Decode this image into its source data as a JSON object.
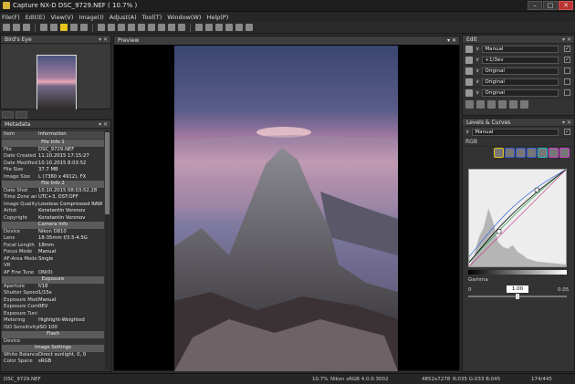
{
  "window": {
    "title": "Capture NX-D    DSC_9729.NEF ( 10.7% )"
  },
  "menu": [
    "File(F)",
    "Edit(E)",
    "View(V)",
    "Image(I)",
    "Adjust(A)",
    "Tool(T)",
    "Window(W)",
    "Help(P)"
  ],
  "panels": {
    "birds_eye": {
      "title": "Bird's Eye"
    },
    "metadata": {
      "title": "Metadata"
    },
    "preview": {
      "title": "Preview"
    },
    "edit": {
      "title": "Edit"
    },
    "levels": {
      "title": "Levels & Curves"
    }
  },
  "metadata": {
    "columns": [
      "Item",
      "Information"
    ],
    "rows": [
      {
        "section": "File Info 1"
      },
      {
        "k": "File",
        "v": "DSC_9729.NEF"
      },
      {
        "k": "Date Created",
        "v": "11.10.2015 17:15:27"
      },
      {
        "k": "Date Modified",
        "v": "10.10.2015 8:03:52"
      },
      {
        "k": "File Size",
        "v": "37.7 MB"
      },
      {
        "k": "Image Size",
        "v": "L (7360 x 4912), FX"
      },
      {
        "section": "File Info 2"
      },
      {
        "k": "Date Shot",
        "v": "10.10.2015 08:03:52.28"
      },
      {
        "k": "Time Zone an",
        "v": "UTC+3, DST:OFF"
      },
      {
        "k": "Image Quality",
        "v": "Lossless Compressed RAW"
      },
      {
        "k": "Artist",
        "v": "Konstantin Voronov"
      },
      {
        "k": "Copyright",
        "v": "Konstantin Voronov"
      },
      {
        "section": "Camera Info"
      },
      {
        "k": "Device",
        "v": "Nikon D810"
      },
      {
        "k": "Lens",
        "v": "18-35mm f/3.5-4.5G"
      },
      {
        "k": "Focal Length",
        "v": "18mm"
      },
      {
        "k": "Focus Mode",
        "v": "Manual"
      },
      {
        "k": "AF-Area Mode",
        "v": "Single"
      },
      {
        "k": "VR",
        "v": ""
      },
      {
        "k": "AF Fine Tune",
        "v": "ON(0)"
      },
      {
        "section": "Exposure"
      },
      {
        "k": "Aperture",
        "v": "f/18"
      },
      {
        "k": "Shutter Speed",
        "v": "1/15s"
      },
      {
        "k": "Exposure Mod",
        "v": "Manual"
      },
      {
        "k": "Exposure Com",
        "v": "0EV"
      },
      {
        "k": "Exposure Tuni",
        "v": ""
      },
      {
        "k": "Metering",
        "v": "Highlight-Weighted"
      },
      {
        "k": "ISO Sensitivity",
        "v": "ISO 100"
      },
      {
        "section": "Flash"
      },
      {
        "k": "Device",
        "v": ""
      },
      {
        "section": "Image Settings"
      },
      {
        "k": "White Balance",
        "v": "Direct sunlight, 0, 0"
      },
      {
        "k": "Color Space",
        "v": "sRGB"
      }
    ]
  },
  "edit": {
    "rows": [
      {
        "value": "Manual",
        "checked": "✓"
      },
      {
        "value": "+1/3ev",
        "checked": "✓"
      },
      {
        "value": "Original",
        "checked": ""
      },
      {
        "value": "Original",
        "checked": ""
      },
      {
        "value": "Original",
        "checked": ""
      }
    ]
  },
  "levels": {
    "preset": "Manual",
    "channel": "RGB",
    "gamma_label": "Gamma",
    "gamma_value": "1.00",
    "gamma_min": "0",
    "gamma_max": "0.05"
  },
  "status": {
    "file": "DSC_9729.NEF",
    "zoom": "10.7%",
    "profile": "Nikon sRGB 4.0.0.3002",
    "size": "4852x7278",
    "rgb": "R:035 G:033 B:045",
    "page": "174/445"
  },
  "colors": {
    "accent": "#e6c619",
    "cyan_group": "#2ab5c8",
    "magenta_group": "#c840c8",
    "blue_group": "#3a5ad6"
  }
}
